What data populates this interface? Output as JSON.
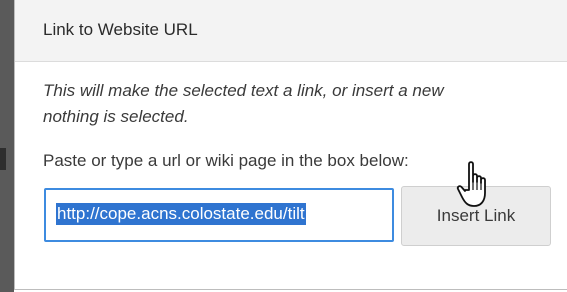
{
  "dialog": {
    "title": "Link to Website URL",
    "help_line_1": "This will make the selected text a link, or insert a new",
    "help_line_2": "nothing is selected.",
    "instruction": "Paste or type a url or wiki page in the box below:",
    "url_value": "http://cope.acns.colostate.edu/tilt",
    "insert_button_label": "Insert Link"
  },
  "icons": {
    "cursor": "hand-pointer-cursor"
  },
  "colors": {
    "header_bg": "#f3f3f3",
    "input_focus_border": "#3d8be0",
    "selection_highlight": "#2f74d0",
    "button_bg": "#ececec"
  }
}
